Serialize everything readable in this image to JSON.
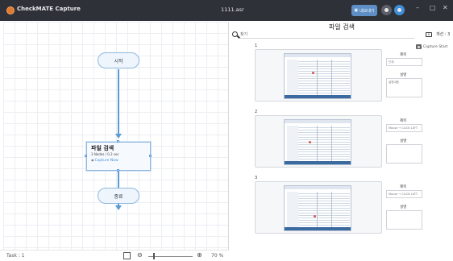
{
  "titlebar": {
    "app_name": "CheckMATE Capture",
    "file_name": "1111.asr",
    "pill_label": "내보내기"
  },
  "flow": {
    "start_label": "시작",
    "end_label": "종료",
    "task": {
      "title": "파일 검색",
      "subtitle": "3 Nodes / 0.3 sec",
      "capture_label": "Capture Now"
    }
  },
  "status": {
    "task_count": "Task : 1",
    "zoom": "70 %"
  },
  "panel": {
    "title": "파일 검색",
    "search_placeholder": "찾기",
    "result_count": "개선 : 3",
    "capture_start": "Capture Start",
    "steps": [
      {
        "num": "1",
        "title_label": "제목",
        "title_value": "단계",
        "desc_label": "설명",
        "desc_value": "설명내용"
      },
      {
        "num": "2",
        "title_label": "제목",
        "title_value": "Mouse → CLICK LEFT",
        "desc_label": "설명",
        "desc_value": ""
      },
      {
        "num": "3",
        "title_label": "제목",
        "title_value": "Mouse → CLICK LEFT",
        "desc_label": "설명",
        "desc_value": ""
      }
    ]
  },
  "colors": {
    "titlebar_bg": "#2f3138",
    "accent_blue": "#5b9bd5",
    "node_fill": "#eef5fc"
  }
}
